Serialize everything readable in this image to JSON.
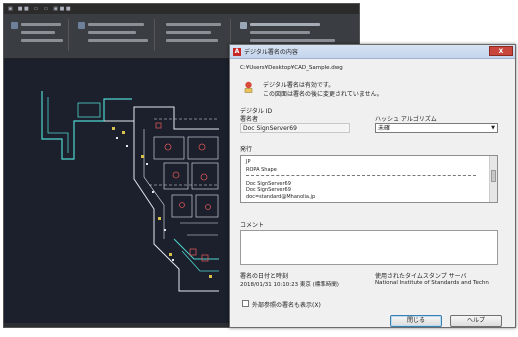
{
  "colors": {
    "cad_background": "#1b202c",
    "cad_lines_cyan": "#4fd6cf",
    "cad_lines_white": "#e4e8ee",
    "cad_lines_red": "#d65454",
    "cad_lines_yellow": "#d9c24d",
    "dialog_background": "#f0f0f0",
    "close_button": "#c9463d"
  },
  "cad": {
    "title_items": [
      "▣",
      "■ ■",
      "▭",
      "▭",
      "▣ ■ ■"
    ]
  },
  "dialog": {
    "title": "デジタル署名の内容",
    "close_glyph": "X",
    "file_path": "C:¥Users¥Desktop¥CAD_Sample.dwg",
    "status_line1": "デジタル署名は有効です。",
    "status_line2": "この図面は署名の後に変更されていません。",
    "digital_id_label": "デジタル ID",
    "signer_label": "署名者",
    "signer_value": "Doc SignServer69",
    "hash_label": "ハッシュ アルゴリズム",
    "hash_value": "未確",
    "cert_section_label": "発行",
    "cert_rows": [
      "JP",
      "ROPA Shape",
      "Doc SignServer69",
      "Doc SignServer69",
      "doc=standard@Mhanolia.jp"
    ],
    "comment_label": "コメント",
    "time_label": "署名の日付と時刻",
    "time_value": "2018/01/31  10:10:23  東京 (標準時間)",
    "ts_label": "使用されたタイムスタンプ サーバ",
    "ts_value": "National Institute of Standards and Techn",
    "checkbox_label": "外部参照の署名も表示(X)",
    "btn_close": "閉じる",
    "btn_help": "ヘルプ"
  }
}
